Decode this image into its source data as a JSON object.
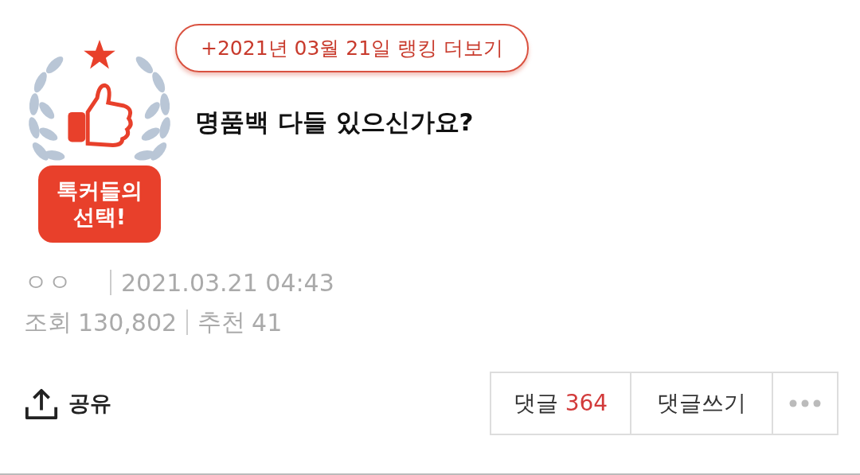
{
  "badge": {
    "lines": [
      "톡커들의",
      "선택!"
    ]
  },
  "ranking_link": "+2021년 03월 21일 랭킹 더보기",
  "title": "명품백 다들 있으신가요?",
  "meta": {
    "author": "ㅇㅇ",
    "date": "2021.03.21 04:43",
    "views_label": "조회",
    "views": "130,802",
    "recommend_label": "추천",
    "recommend": "41"
  },
  "share": {
    "label": "공유"
  },
  "actions": {
    "comments_label": "댓글",
    "comments_count": "364",
    "write_label": "댓글쓰기"
  }
}
